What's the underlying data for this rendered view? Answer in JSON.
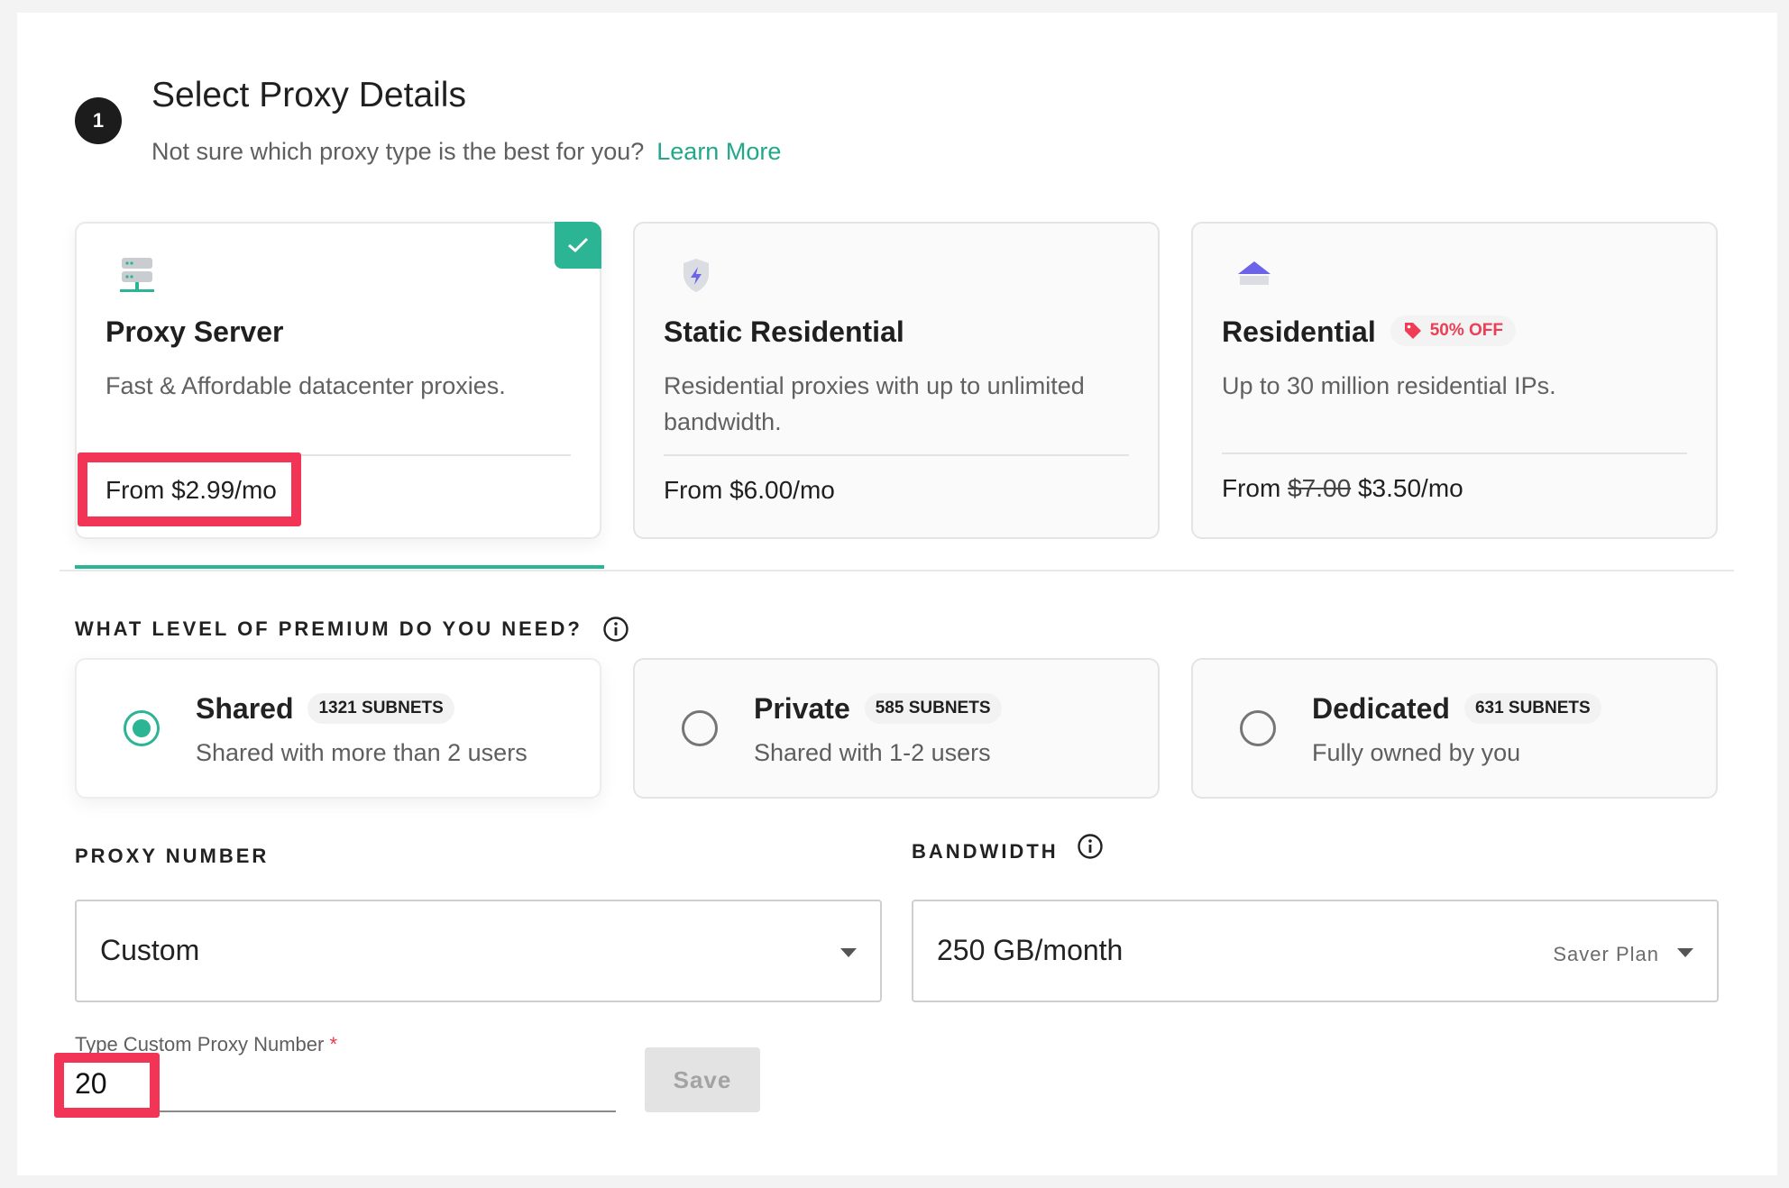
{
  "step": {
    "number": "1",
    "title": "Select Proxy Details",
    "subtitle": "Not sure which proxy type is the best for you?",
    "learn_more": "Learn More"
  },
  "proxy_types": [
    {
      "name": "Proxy Server",
      "description": "Fast & Affordable datacenter proxies.",
      "price": "From $2.99/mo",
      "selected": true,
      "icon": "server-icon"
    },
    {
      "name": "Static Residential",
      "description": "Residential proxies with up to unlimited bandwidth.",
      "price": "From $6.00/mo",
      "selected": false,
      "icon": "shield-bolt-icon"
    },
    {
      "name": "Residential",
      "badge": "50% OFF",
      "description": "Up to 30 million residential IPs.",
      "price_prefix": "From",
      "price_old": "$7.00",
      "price_new": "$3.50/mo",
      "selected": false,
      "icon": "house-icon"
    }
  ],
  "premium": {
    "label": "WHAT LEVEL OF PREMIUM DO YOU NEED?",
    "options": [
      {
        "name": "Shared",
        "subnets": "1321 SUBNETS",
        "description": "Shared with more than 2 users",
        "selected": true
      },
      {
        "name": "Private",
        "subnets": "585 SUBNETS",
        "description": "Shared with 1-2 users",
        "selected": false
      },
      {
        "name": "Dedicated",
        "subnets": "631 SUBNETS",
        "description": "Fully owned by you",
        "selected": false
      }
    ]
  },
  "proxy_number": {
    "label": "PROXY NUMBER",
    "value": "Custom"
  },
  "bandwidth": {
    "label": "BANDWIDTH",
    "value": "250 GB/month",
    "plan": "Saver Plan"
  },
  "custom_input": {
    "label": "Type Custom Proxy Number",
    "required_mark": "*",
    "value": "20"
  },
  "save_label": "Save",
  "colors": {
    "accent": "#2bb594",
    "highlight": "#f23557",
    "badge": "#ee3e55"
  }
}
